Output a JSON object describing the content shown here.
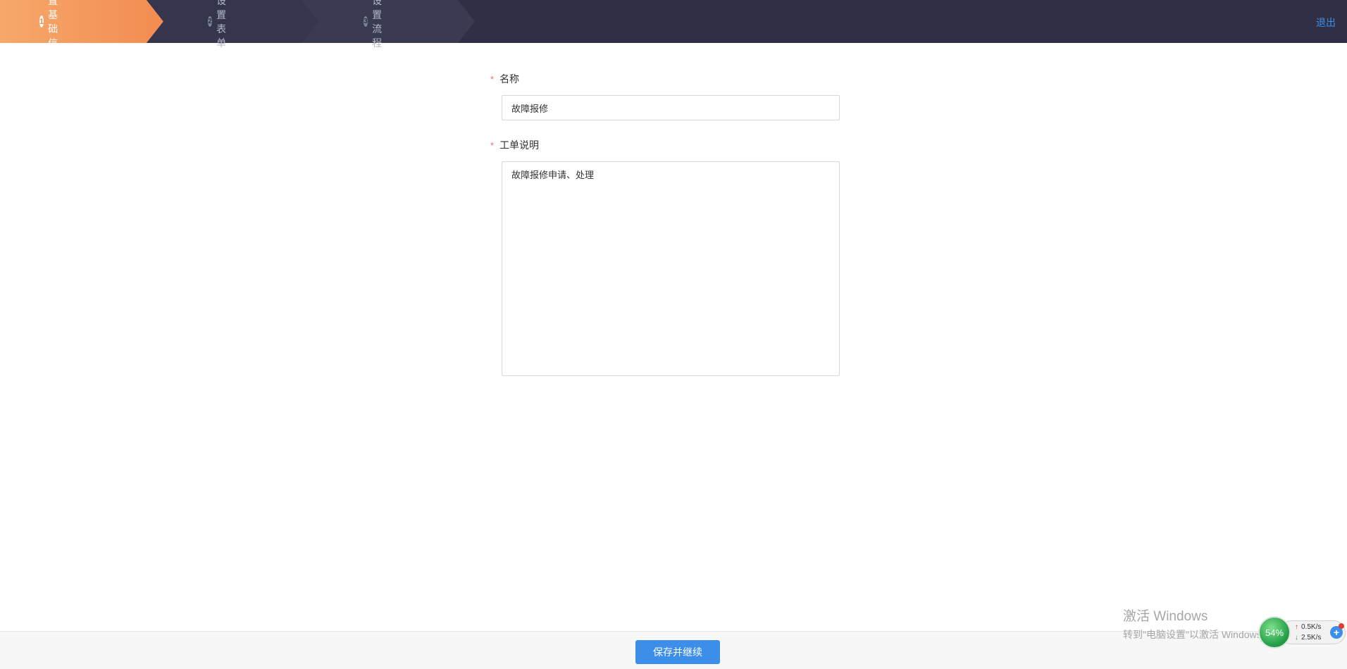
{
  "header": {
    "steps": [
      {
        "number": "1",
        "label": "设置基础信息",
        "active": true
      },
      {
        "number": "2",
        "label": "设置表单",
        "active": false
      },
      {
        "number": "3",
        "label": "设置流程",
        "active": false
      }
    ],
    "logout_label": "退出",
    "colors": {
      "bar": "#2f3046",
      "active_step": "#f0894c",
      "link": "#3d8ee8"
    }
  },
  "form": {
    "name": {
      "required_mark": "*",
      "label": "名称",
      "value": "故障报修"
    },
    "description": {
      "required_mark": "*",
      "label": "工单说明",
      "value": "故障报修申请、处理"
    }
  },
  "footer": {
    "save_label": "保存并继续"
  },
  "watermark": {
    "title": "激活 Windows",
    "subtitle": "转到\"电脑设置\"以激活 Windows。"
  },
  "net_widget": {
    "percent": "54%",
    "upload": "0.5K/s",
    "download": "2.5K/s",
    "add_icon": "plus-icon"
  }
}
